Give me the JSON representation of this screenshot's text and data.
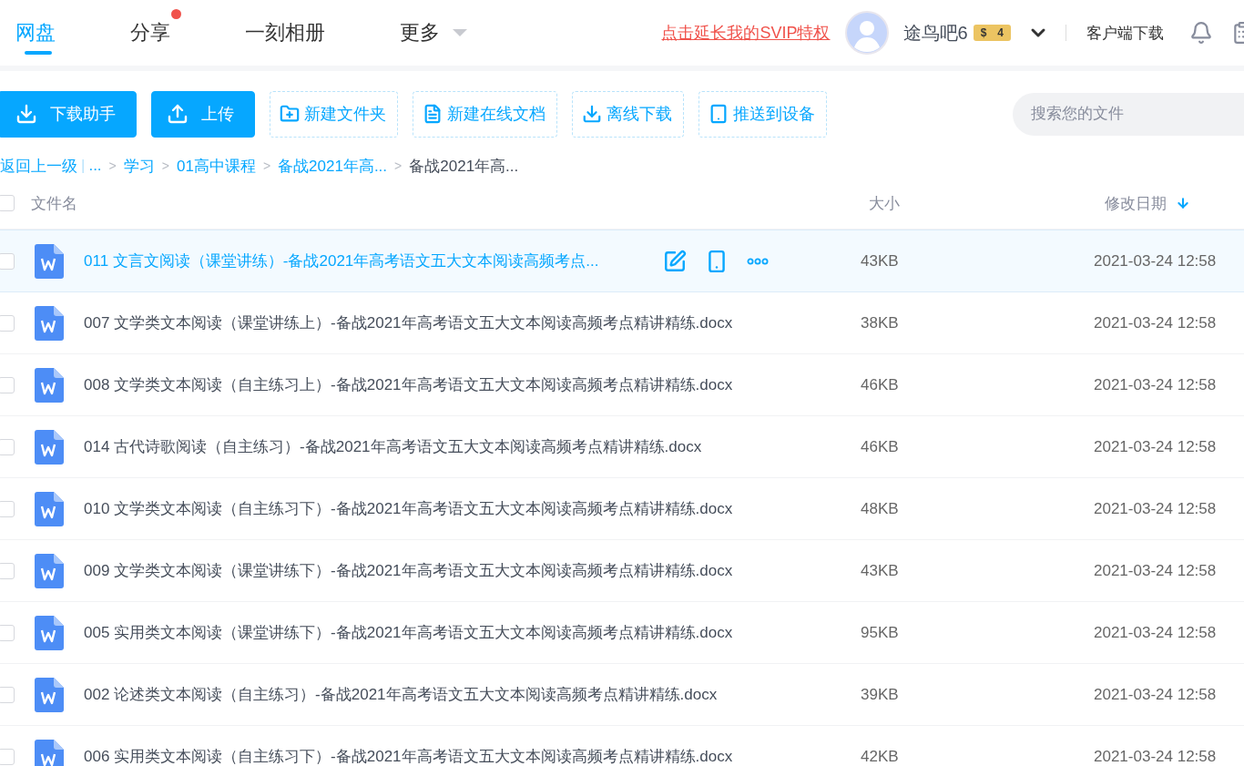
{
  "nav": {
    "tabs": [
      {
        "label": "网盘",
        "selected": true,
        "badge": false,
        "dropdown": false
      },
      {
        "label": "分享",
        "selected": false,
        "badge": true,
        "dropdown": false
      },
      {
        "label": "一刻相册",
        "selected": false,
        "badge": false,
        "dropdown": false
      },
      {
        "label": "更多",
        "selected": false,
        "badge": false,
        "dropdown": true
      }
    ]
  },
  "account": {
    "promo_link": "点击延长我的SVIP特权",
    "username": "途鸟吧6",
    "coin_symbol": "$",
    "coins": "4",
    "client_download": "客户端下载"
  },
  "toolbar": {
    "buttons": [
      {
        "label": "下载助手",
        "kind": "primary"
      },
      {
        "label": "上传",
        "kind": "primary"
      },
      {
        "label": "新建文件夹",
        "kind": "outline"
      },
      {
        "label": "新建在线文档",
        "kind": "outline"
      },
      {
        "label": "离线下载",
        "kind": "outline"
      },
      {
        "label": "推送到设备",
        "kind": "outline"
      }
    ],
    "search": {
      "placeholder": "搜索您的文件"
    }
  },
  "breadcrumb": {
    "back": "返回上一级",
    "divider": "|",
    "separator": ">",
    "items": [
      {
        "label": "...",
        "current": false
      },
      {
        "label": "学习",
        "current": false
      },
      {
        "label": "01高中课程",
        "current": false
      },
      {
        "label": "备战2021年高...",
        "current": false
      },
      {
        "label": "备战2021年高...",
        "current": true
      }
    ]
  },
  "table": {
    "select_all": {
      "checked": false
    },
    "columns": [
      {
        "label": "文件名",
        "sorted": false
      },
      {
        "label": "大小",
        "sorted": false
      },
      {
        "label": "修改日期",
        "sorted": true
      }
    ],
    "rows": [
      {
        "name": "011 文言文阅读（课堂讲练）-备战2021年高考语文五大文本阅读高频考点...",
        "size": "43KB",
        "date": "2021-03-24 12:58",
        "highlighted": true,
        "checked": false
      },
      {
        "name": "007 文学类文本阅读（课堂讲练上）-备战2021年高考语文五大文本阅读高频考点精讲精练.docx",
        "size": "38KB",
        "date": "2021-03-24 12:58",
        "highlighted": false,
        "checked": false
      },
      {
        "name": "008 文学类文本阅读（自主练习上）-备战2021年高考语文五大文本阅读高频考点精讲精练.docx",
        "size": "46KB",
        "date": "2021-03-24 12:58",
        "highlighted": false,
        "checked": false
      },
      {
        "name": "014 古代诗歌阅读（自主练习）-备战2021年高考语文五大文本阅读高频考点精讲精练.docx",
        "size": "46KB",
        "date": "2021-03-24 12:58",
        "highlighted": false,
        "checked": false
      },
      {
        "name": "010 文学类文本阅读（自主练习下）-备战2021年高考语文五大文本阅读高频考点精讲精练.docx",
        "size": "48KB",
        "date": "2021-03-24 12:58",
        "highlighted": false,
        "checked": false
      },
      {
        "name": "009 文学类文本阅读（课堂讲练下）-备战2021年高考语文五大文本阅读高频考点精讲精练.docx",
        "size": "43KB",
        "date": "2021-03-24 12:58",
        "highlighted": false,
        "checked": false
      },
      {
        "name": "005 实用类文本阅读（课堂讲练下）-备战2021年高考语文五大文本阅读高频考点精讲精练.docx",
        "size": "95KB",
        "date": "2021-03-24 12:58",
        "highlighted": false,
        "checked": false
      },
      {
        "name": "002 论述类文本阅读（自主练习）-备战2021年高考语文五大文本阅读高频考点精讲精练.docx",
        "size": "39KB",
        "date": "2021-03-24 12:58",
        "highlighted": false,
        "checked": false
      },
      {
        "name": "006 实用类文本阅读（自主练习下）-备战2021年高考语文五大文本阅读高频考点精讲精练.docx",
        "size": "42KB",
        "date": "2021-03-24 12:58",
        "highlighted": false,
        "checked": false
      }
    ]
  }
}
